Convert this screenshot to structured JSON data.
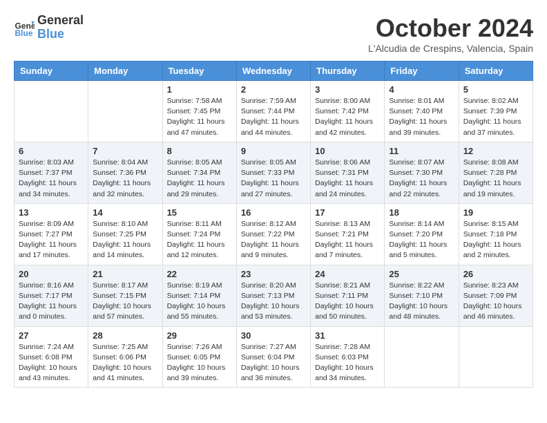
{
  "header": {
    "logo_general": "General",
    "logo_blue": "Blue",
    "month_title": "October 2024",
    "location": "L'Alcudia de Crespins, Valencia, Spain"
  },
  "weekdays": [
    "Sunday",
    "Monday",
    "Tuesday",
    "Wednesday",
    "Thursday",
    "Friday",
    "Saturday"
  ],
  "weeks": [
    [
      {
        "day": "",
        "info": ""
      },
      {
        "day": "",
        "info": ""
      },
      {
        "day": "1",
        "info": "Sunrise: 7:58 AM\nSunset: 7:45 PM\nDaylight: 11 hours and 47 minutes."
      },
      {
        "day": "2",
        "info": "Sunrise: 7:59 AM\nSunset: 7:44 PM\nDaylight: 11 hours and 44 minutes."
      },
      {
        "day": "3",
        "info": "Sunrise: 8:00 AM\nSunset: 7:42 PM\nDaylight: 11 hours and 42 minutes."
      },
      {
        "day": "4",
        "info": "Sunrise: 8:01 AM\nSunset: 7:40 PM\nDaylight: 11 hours and 39 minutes."
      },
      {
        "day": "5",
        "info": "Sunrise: 8:02 AM\nSunset: 7:39 PM\nDaylight: 11 hours and 37 minutes."
      }
    ],
    [
      {
        "day": "6",
        "info": "Sunrise: 8:03 AM\nSunset: 7:37 PM\nDaylight: 11 hours and 34 minutes."
      },
      {
        "day": "7",
        "info": "Sunrise: 8:04 AM\nSunset: 7:36 PM\nDaylight: 11 hours and 32 minutes."
      },
      {
        "day": "8",
        "info": "Sunrise: 8:05 AM\nSunset: 7:34 PM\nDaylight: 11 hours and 29 minutes."
      },
      {
        "day": "9",
        "info": "Sunrise: 8:05 AM\nSunset: 7:33 PM\nDaylight: 11 hours and 27 minutes."
      },
      {
        "day": "10",
        "info": "Sunrise: 8:06 AM\nSunset: 7:31 PM\nDaylight: 11 hours and 24 minutes."
      },
      {
        "day": "11",
        "info": "Sunrise: 8:07 AM\nSunset: 7:30 PM\nDaylight: 11 hours and 22 minutes."
      },
      {
        "day": "12",
        "info": "Sunrise: 8:08 AM\nSunset: 7:28 PM\nDaylight: 11 hours and 19 minutes."
      }
    ],
    [
      {
        "day": "13",
        "info": "Sunrise: 8:09 AM\nSunset: 7:27 PM\nDaylight: 11 hours and 17 minutes."
      },
      {
        "day": "14",
        "info": "Sunrise: 8:10 AM\nSunset: 7:25 PM\nDaylight: 11 hours and 14 minutes."
      },
      {
        "day": "15",
        "info": "Sunrise: 8:11 AM\nSunset: 7:24 PM\nDaylight: 11 hours and 12 minutes."
      },
      {
        "day": "16",
        "info": "Sunrise: 8:12 AM\nSunset: 7:22 PM\nDaylight: 11 hours and 9 minutes."
      },
      {
        "day": "17",
        "info": "Sunrise: 8:13 AM\nSunset: 7:21 PM\nDaylight: 11 hours and 7 minutes."
      },
      {
        "day": "18",
        "info": "Sunrise: 8:14 AM\nSunset: 7:20 PM\nDaylight: 11 hours and 5 minutes."
      },
      {
        "day": "19",
        "info": "Sunrise: 8:15 AM\nSunset: 7:18 PM\nDaylight: 11 hours and 2 minutes."
      }
    ],
    [
      {
        "day": "20",
        "info": "Sunrise: 8:16 AM\nSunset: 7:17 PM\nDaylight: 11 hours and 0 minutes."
      },
      {
        "day": "21",
        "info": "Sunrise: 8:17 AM\nSunset: 7:15 PM\nDaylight: 10 hours and 57 minutes."
      },
      {
        "day": "22",
        "info": "Sunrise: 8:19 AM\nSunset: 7:14 PM\nDaylight: 10 hours and 55 minutes."
      },
      {
        "day": "23",
        "info": "Sunrise: 8:20 AM\nSunset: 7:13 PM\nDaylight: 10 hours and 53 minutes."
      },
      {
        "day": "24",
        "info": "Sunrise: 8:21 AM\nSunset: 7:11 PM\nDaylight: 10 hours and 50 minutes."
      },
      {
        "day": "25",
        "info": "Sunrise: 8:22 AM\nSunset: 7:10 PM\nDaylight: 10 hours and 48 minutes."
      },
      {
        "day": "26",
        "info": "Sunrise: 8:23 AM\nSunset: 7:09 PM\nDaylight: 10 hours and 46 minutes."
      }
    ],
    [
      {
        "day": "27",
        "info": "Sunrise: 7:24 AM\nSunset: 6:08 PM\nDaylight: 10 hours and 43 minutes."
      },
      {
        "day": "28",
        "info": "Sunrise: 7:25 AM\nSunset: 6:06 PM\nDaylight: 10 hours and 41 minutes."
      },
      {
        "day": "29",
        "info": "Sunrise: 7:26 AM\nSunset: 6:05 PM\nDaylight: 10 hours and 39 minutes."
      },
      {
        "day": "30",
        "info": "Sunrise: 7:27 AM\nSunset: 6:04 PM\nDaylight: 10 hours and 36 minutes."
      },
      {
        "day": "31",
        "info": "Sunrise: 7:28 AM\nSunset: 6:03 PM\nDaylight: 10 hours and 34 minutes."
      },
      {
        "day": "",
        "info": ""
      },
      {
        "day": "",
        "info": ""
      }
    ]
  ]
}
